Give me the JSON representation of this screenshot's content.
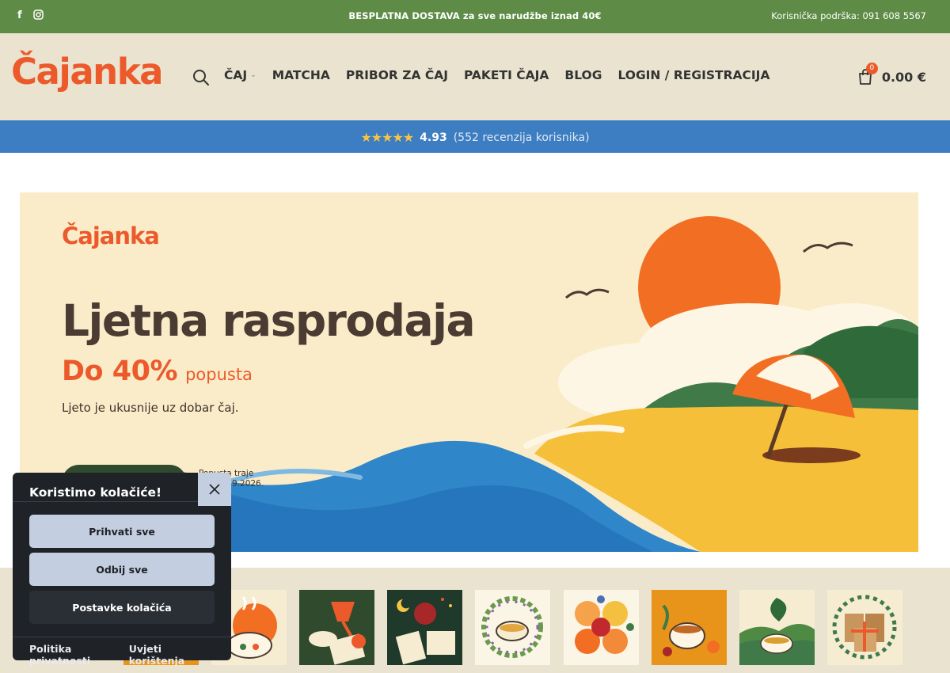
{
  "topbar": {
    "social_icons": [
      "facebook-icon",
      "instagram-icon"
    ],
    "promo": "BESPLATNA DOSTAVA za sve narudžbe iznad 40€",
    "support": "Korisnička podrška: 091 608 5567",
    "bg_color": "#5e8c47"
  },
  "header": {
    "logo": "Čajanka",
    "nav": [
      {
        "label": "ČAJ",
        "has_dropdown": true
      },
      {
        "label": "MATCHA"
      },
      {
        "label": "PRIBOR ZA ČAJ"
      },
      {
        "label": "PAKETI ČAJA"
      },
      {
        "label": "BLOG"
      },
      {
        "label": "LOGIN / REGISTRACIJA"
      }
    ],
    "cart_count": "0",
    "cart_total": "0.00 €",
    "bg_color": "#e9e3cf"
  },
  "rating": {
    "stars": "★★★★★",
    "score": "4.93",
    "reviews": "(552 recenzija korisnika)",
    "bg_color": "#3c7ec1"
  },
  "hero": {
    "brand": "Čajanka",
    "title": "Ljetna rasprodaja",
    "discount_big": "Do 40%",
    "discount_small": "popusta",
    "tagline": "Ljeto je ukusnije uz dobar čaj.",
    "duration_line1": "Popusta traje",
    "duration_line2": "9.2026.",
    "accent_color": "#ec5a2b"
  },
  "categories": {
    "tiles": [
      "tea-cup-sun-icon",
      "lamp-tea-icon",
      "night-tea-book-icon",
      "herbal-wreath-tea-icon",
      "citrus-slices-icon",
      "spiced-tea-icon",
      "green-tea-landscape-icon",
      "gift-bags-icon"
    ]
  },
  "cookie": {
    "title": "Koristimo kolačiće!",
    "accept_all": "Prihvati sve",
    "reject_all": "Odbij sve",
    "settings": "Postavke kolačića",
    "privacy": "Politika privatnosti",
    "terms": "Uvjeti korištenja"
  }
}
